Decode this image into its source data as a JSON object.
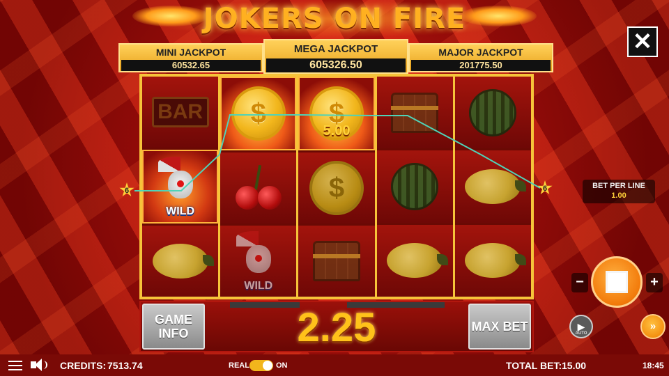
{
  "game": {
    "title": "JOKERS ON FIRE"
  },
  "jackpots": {
    "mini": {
      "label": "MINI JACKPOT",
      "value": "60532.65"
    },
    "mega": {
      "label": "MEGA JACKPOT",
      "value": "605326.50"
    },
    "major": {
      "label": "MAJOR JACKPOT",
      "value": "201775.50"
    }
  },
  "reels": [
    [
      "bar",
      "joker-wild",
      "lemon"
    ],
    [
      "coin",
      "cherry",
      "joker-wild"
    ],
    [
      "coin",
      "coin",
      "chest"
    ],
    [
      "chest",
      "melon",
      "lemon"
    ],
    [
      "melon",
      "lemon",
      "lemon"
    ]
  ],
  "symbols": {
    "bar_text": "BAR",
    "wild_text": "WILD",
    "coin_glyph": "$",
    "coin_value": "5.00"
  },
  "paylines": {
    "active_line_number": "6",
    "line_color": "#4fd3b8"
  },
  "bet_per_line": {
    "label": "BET PER LINE",
    "value": "1.00"
  },
  "controls": {
    "minus": "−",
    "plus": "+",
    "close": "✕",
    "auto_glyph": "▶",
    "auto_label": "AUTO",
    "turbo_glyph": "»"
  },
  "panel": {
    "game_info_label": "GAME INFO",
    "max_bet_label": "MAX BET",
    "win_amount": "2.25"
  },
  "status": {
    "credits_label": "CREDITS:",
    "credits_value": "7513.74",
    "real_label": "REAL",
    "real_on": true,
    "on_label": "ON",
    "total_bet_label": "TOTAL BET:",
    "total_bet_value": "15.00",
    "clock": "18:45"
  },
  "colors": {
    "accent_gold": "#ffc21a",
    "spin_orange": "#f27a0a"
  }
}
